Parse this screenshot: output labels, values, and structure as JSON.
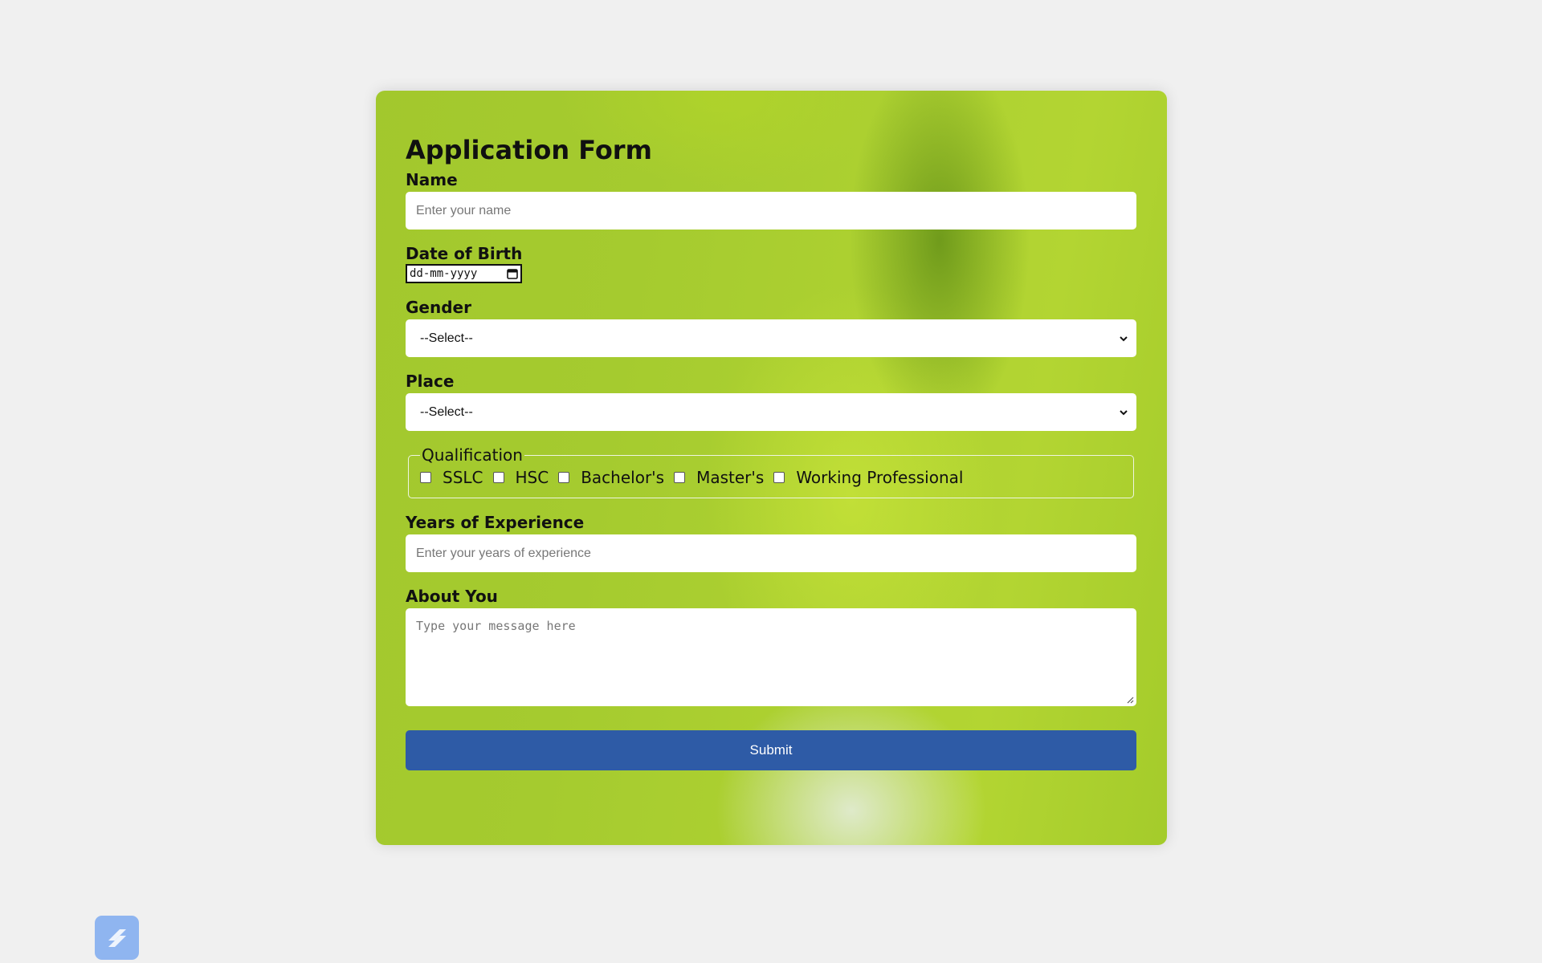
{
  "form": {
    "title": "Application Form",
    "name_label": "Name",
    "name_placeholder": "Enter your name",
    "dob_label": "Date of Birth",
    "dob_placeholder": "dd-mm-yyyy",
    "gender_label": "Gender",
    "gender_selected": "--Select--",
    "place_label": "Place",
    "place_selected": "--Select--",
    "qualification_legend": "Qualification",
    "qualifications": [
      "SSLC",
      "HSC",
      "Bachelor's",
      "Master's",
      "Working Professional"
    ],
    "experience_label": "Years of Experience",
    "experience_placeholder": "Enter your years of experience",
    "about_label": "About You",
    "about_placeholder": "Type your message here",
    "submit_label": "Submit"
  },
  "colors": {
    "page_background": "#f0f0f0",
    "submit_button": "#2e5ba6",
    "app_icon": "#8fb5f0"
  },
  "icons": {
    "calendar": "calendar-icon",
    "select_chevron": "chevron-down-icon",
    "taskbar_app": "app-icon"
  }
}
